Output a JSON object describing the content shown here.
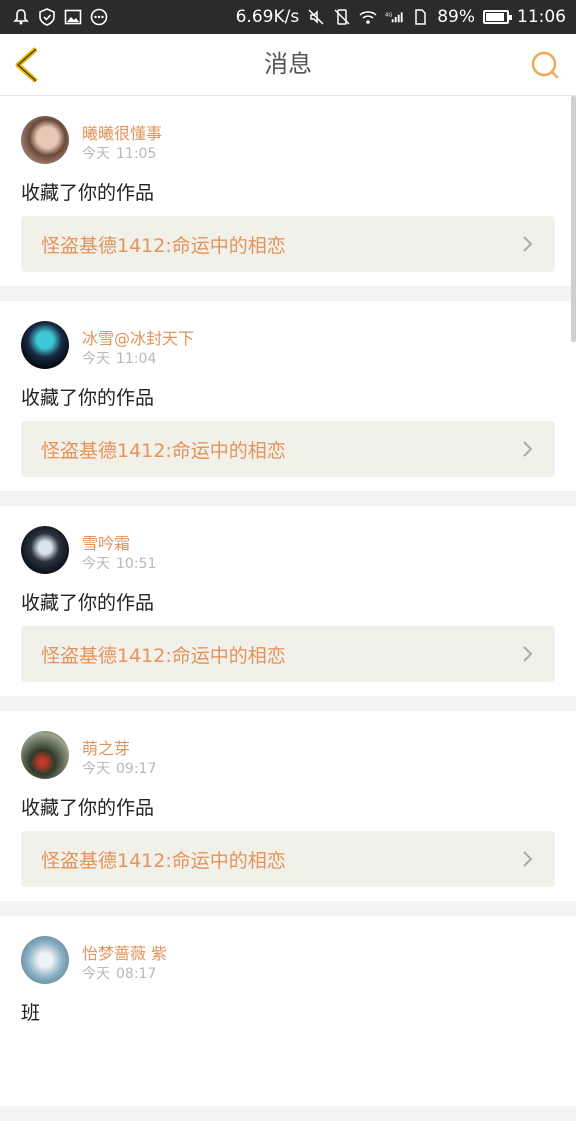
{
  "status_bar": {
    "speed": "6.69K/s",
    "network": "4G",
    "battery": "89%",
    "battery_level": 0.89,
    "time": "11:06"
  },
  "header": {
    "title": "消息"
  },
  "messages": [
    {
      "username": "曦曦很懂事",
      "day": "今天",
      "time": "11:05",
      "action": "收藏了你的作品",
      "work": "怪盗基德1412:命运中的相恋"
    },
    {
      "username": "冰雪@冰封天下",
      "day": "今天",
      "time": "11:04",
      "action": "收藏了你的作品",
      "work": "怪盗基德1412:命运中的相恋"
    },
    {
      "username": "雪吟霜",
      "day": "今天",
      "time": "10:51",
      "action": "收藏了你的作品",
      "work": "怪盗基德1412:命运中的相恋"
    },
    {
      "username": "萌之芽",
      "day": "今天",
      "time": "09:17",
      "action": "收藏了你的作品",
      "work": "怪盗基德1412:命运中的相恋"
    },
    {
      "username": "怡梦蔷薇 紫",
      "day": "今天",
      "time": "08:17",
      "action": "班",
      "work": ""
    }
  ],
  "colors": {
    "accent": "#e4935c",
    "header_icon": "#e8b400",
    "work_bg": "#f1f1e9"
  }
}
